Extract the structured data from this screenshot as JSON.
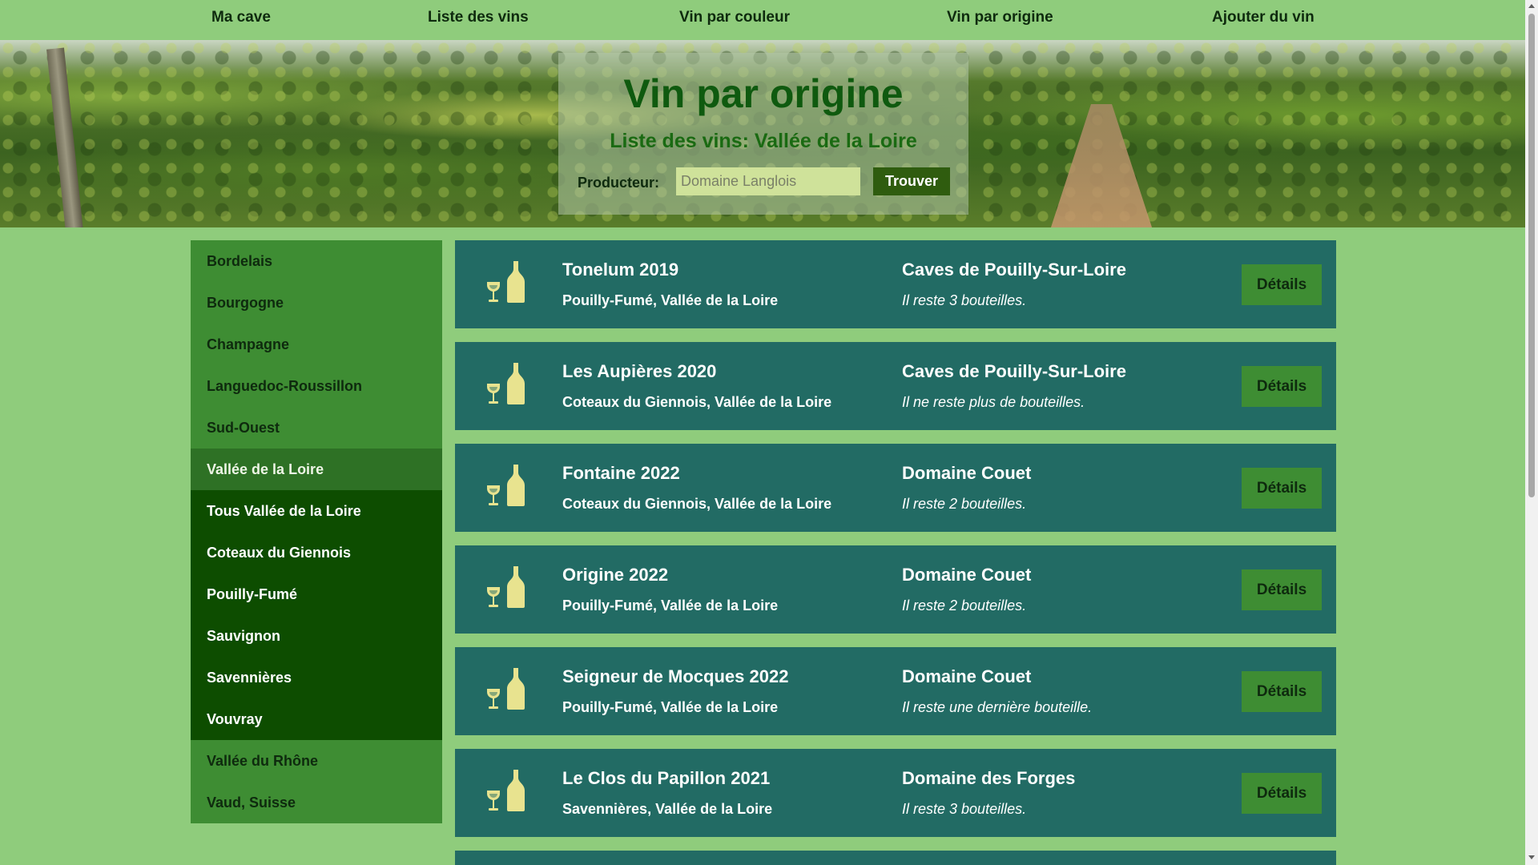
{
  "nav": {
    "items": [
      "Ma cave",
      "Liste des vins",
      "Vin par couleur",
      "Vin par origine",
      "Ajouter du vin"
    ]
  },
  "hero": {
    "title": "Vin par origine",
    "subtitle": "Liste des vins: Vallée de la Loire",
    "search_label": "Producteur:",
    "search_placeholder": "Domaine Langlois",
    "search_button": "Trouver"
  },
  "sidebar": {
    "regions_top": [
      "Bordelais",
      "Bourgogne",
      "Champagne",
      "Languedoc-Roussillon",
      "Sud-Ouest"
    ],
    "active": "Vallée de la Loire",
    "subregions": [
      "Tous Vallée de la Loire",
      "Coteaux du Giennois",
      "Pouilly-Fumé",
      "Sauvignon",
      "Savennières",
      "Vouvray"
    ],
    "regions_bottom": [
      "Vallée du Rhône",
      "Vaud, Suisse"
    ]
  },
  "wines": [
    {
      "name": "Tonelum 2019",
      "origin": "Pouilly-Fumé, Vallée de la Loire",
      "producer": "Caves de Pouilly-Sur-Loire",
      "stock": "Il reste 3 bouteilles.",
      "details": "Détails"
    },
    {
      "name": "Les Aupières 2020",
      "origin": "Coteaux du Giennois, Vallée de la Loire",
      "producer": "Caves de Pouilly-Sur-Loire",
      "stock": "Il ne reste plus de bouteilles.",
      "details": "Détails"
    },
    {
      "name": "Fontaine 2022",
      "origin": "Coteaux du Giennois, Vallée de la Loire",
      "producer": "Domaine Couet",
      "stock": "Il reste 2 bouteilles.",
      "details": "Détails"
    },
    {
      "name": "Origine 2022",
      "origin": "Pouilly-Fumé, Vallée de la Loire",
      "producer": "Domaine Couet",
      "stock": "Il reste 2 bouteilles.",
      "details": "Détails"
    },
    {
      "name": "Seigneur de Mocques 2022",
      "origin": "Pouilly-Fumé, Vallée de la Loire",
      "producer": "Domaine Couet",
      "stock": "Il reste une dernière bouteille.",
      "details": "Détails"
    },
    {
      "name": "Le Clos du Papillon 2021",
      "origin": "Savennières, Vallée de la Loire",
      "producer": "Domaine des Forges",
      "stock": "Il reste 3 bouteilles.",
      "details": "Détails"
    }
  ],
  "icons": {
    "wine_glass": "wine-glass-icon",
    "wine_bottle": "wine-bottle-icon"
  },
  "colors": {
    "page_bg": "#8fcc7c",
    "card_bg": "#226b64",
    "button_bg": "#3e8d33",
    "subregion_bg": "#0d4d00",
    "icon_color": "#e8e38f",
    "title_green": "#0f5a0f"
  }
}
